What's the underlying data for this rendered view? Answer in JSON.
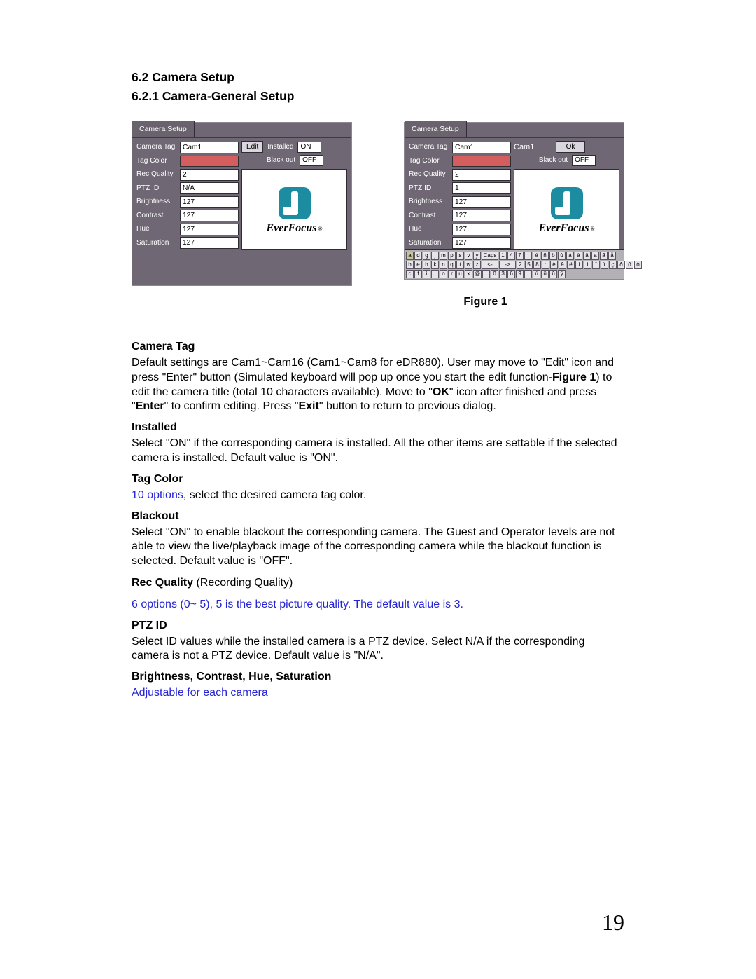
{
  "headings": {
    "section": "6.2 Camera Setup",
    "subsection": "6.2.1 Camera-General Setup"
  },
  "panels": {
    "left": {
      "tab": "Camera Setup",
      "fields": [
        {
          "label": "Camera Tag",
          "value": "Cam1",
          "type": "text"
        },
        {
          "label": "Tag Color",
          "value": "#d45e5e",
          "type": "swatch"
        },
        {
          "label": "Rec Quality",
          "value": "2",
          "type": "text"
        },
        {
          "label": "PTZ ID",
          "value": "N/A",
          "type": "text"
        },
        {
          "label": "Brightness",
          "value": "127",
          "type": "text"
        },
        {
          "label": "Contrast",
          "value": "127",
          "type": "text"
        },
        {
          "label": "Hue",
          "value": "127",
          "type": "text"
        },
        {
          "label": "Saturation",
          "value": "127",
          "type": "text"
        }
      ],
      "side": {
        "edit_btn": "Edit",
        "installed_label": "Installed",
        "installed_value": "ON",
        "blackout_label": "Black out",
        "blackout_value": "OFF",
        "logo_text": "EverFocus",
        "logo_reg": "®"
      }
    },
    "right": {
      "tab": "Camera Setup",
      "fields": [
        {
          "label": "Camera Tag",
          "value": "Cam1",
          "type": "text"
        },
        {
          "label": "Tag Color",
          "value": "#d45e5e",
          "type": "swatch"
        },
        {
          "label": "Rec Quality",
          "value": "2",
          "type": "text"
        },
        {
          "label": "PTZ ID",
          "value": "1",
          "type": "text"
        },
        {
          "label": "Brightness",
          "value": "127",
          "type": "text"
        },
        {
          "label": "Contrast",
          "value": "127",
          "type": "text"
        },
        {
          "label": "Hue",
          "value": "127",
          "type": "text"
        },
        {
          "label": "Saturation",
          "value": "127",
          "type": "text"
        }
      ],
      "side": {
        "edit_value": "Cam1",
        "ok_btn": "Ok",
        "blackout_label": "Black out",
        "blackout_value": "OFF",
        "logo_text": "EverFocus",
        "logo_reg": "®"
      },
      "keyboard": {
        "rows": [
          [
            "a",
            "d",
            "g",
            "j",
            "m",
            "p",
            "s",
            "v",
            "y",
            "Caps",
            "1",
            "4",
            "7",
            ".",
            "é",
            "ñ",
            "ö",
            "ù",
            "á",
            "à",
            "â",
            "a",
            "ã",
            "å"
          ],
          [
            "b",
            "e",
            "h",
            "k",
            "n",
            "q",
            "t",
            "w",
            "z",
            "<-",
            "->",
            "2",
            "5",
            "8",
            ":",
            "è",
            "ê",
            "ë",
            "í",
            "ì",
            "î",
            "ï",
            "ç",
            "ð",
            "ô",
            "ò"
          ],
          [
            "c",
            "f",
            "i",
            "l",
            "o",
            "r",
            "u",
            "x",
            "@",
            ",",
            "0",
            "3",
            "6",
            "9",
            ";",
            "ú",
            "ü",
            "û",
            "ý"
          ]
        ]
      }
    }
  },
  "figure_caption": "Figure 1",
  "body": {
    "camera_tag": {
      "heading": "Camera Tag",
      "text_a": "Default settings are Cam1~Cam16 (Cam1~Cam8 for eDR880). User may move to \"Edit\" icon and press \"Enter\" button (Simulated keyboard will pop up once you start the edit function-",
      "figure_ref": "Figure 1",
      "text_b": ") to edit the camera title (total 10 characters available). Move to \"",
      "ok": "OK",
      "text_c": "\" icon after finished and press \"",
      "enter": "Enter",
      "text_d": "\" to confirm editing. Press \"",
      "exit": "Exit",
      "text_e": "\" button to return to previous dialog."
    },
    "installed": {
      "heading": "Installed",
      "text": "Select \"ON\" if the corresponding camera is installed. All the other items are settable if the selected camera is installed. Default value is \"ON\"."
    },
    "tag_color": {
      "heading": "Tag Color",
      "blue": "10 options",
      "rest": ", select the desired camera tag color."
    },
    "blackout": {
      "heading": "Blackout",
      "text": "Select \"ON\" to enable blackout the corresponding camera. The Guest and Operator levels are not able to view the live/playback image of the corresponding camera while the blackout function is selected. Default value is \"OFF\"."
    },
    "rec_quality": {
      "heading_bold": "Rec Quality",
      "heading_rest": " (Recording Quality)",
      "blue": "6 options (0~ 5), 5 is the best picture quality. The default value is 3."
    },
    "ptz_id": {
      "heading": "PTZ ID",
      "text": "Select ID values while the installed camera is a PTZ device. Select N/A if the corresponding camera is not a PTZ device. Default value is \"N/A\"."
    },
    "bchs": {
      "heading": "Brightness, Contrast, Hue, Saturation",
      "blue": "Adjustable for each camera"
    }
  },
  "page_number": "19"
}
